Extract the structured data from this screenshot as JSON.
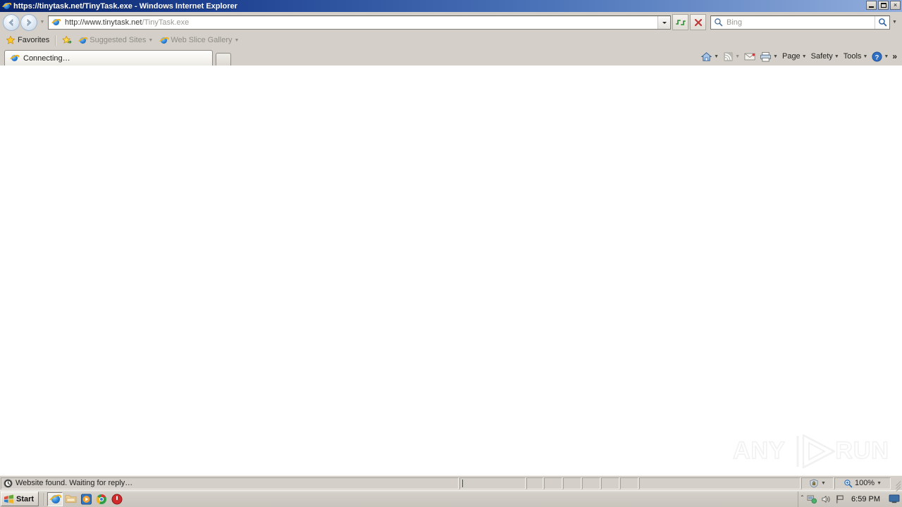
{
  "window": {
    "title": "https://tinytask.net/TinyTask.exe - Windows Internet Explorer",
    "icon": "ie-logo-icon",
    "controls": {
      "minimize": "Minimize",
      "restore": "Restore",
      "close": "×"
    }
  },
  "navigation": {
    "back_label": "Back",
    "forward_label": "Forward",
    "recent_pages_label": "Recent Pages",
    "address": {
      "scheme_host": "http://www.tinytask.net",
      "path": "/TinyTask.exe",
      "full": "http://www.tinytask.net/TinyTask.exe",
      "dropdown_label": "Address dropdown"
    },
    "refresh_label": "Refresh",
    "stop_label": "Stop",
    "search": {
      "placeholder": "Bing",
      "value": "",
      "go_label": "Search",
      "dropdown_label": "Search options"
    }
  },
  "favorites_bar": {
    "favorites_label": "Favorites",
    "items": [
      {
        "label": "Suggested Sites",
        "icon": "ie-logo-icon",
        "has_caret": true
      },
      {
        "label": "Web Slice Gallery",
        "icon": "ie-logo-icon",
        "has_caret": true
      }
    ]
  },
  "tabs": {
    "items": [
      {
        "label": "Connecting…",
        "icon": "ie-logo-icon",
        "active": true
      }
    ],
    "new_tab_label": "New Tab"
  },
  "command_bar": {
    "items": [
      {
        "label": "",
        "icon": "home-icon",
        "has_caret": true
      },
      {
        "label": "",
        "icon": "rss-feed-icon",
        "has_caret": true
      },
      {
        "label": "",
        "icon": "mail-icon",
        "has_caret": false
      },
      {
        "label": "",
        "icon": "print-icon",
        "has_caret": true
      },
      {
        "label": "Page",
        "icon": "",
        "has_caret": true
      },
      {
        "label": "Safety",
        "icon": "",
        "has_caret": true
      },
      {
        "label": "Tools",
        "icon": "",
        "has_caret": true
      },
      {
        "label": "",
        "icon": "help-icon",
        "has_caret": true
      }
    ],
    "overflow_label": "»"
  },
  "page": {
    "body_text": "",
    "watermark": {
      "left": "ANY",
      "right": "RUN",
      "logo": "play-triangle-icon"
    }
  },
  "status_bar": {
    "message": "Website found. Waiting for reply…",
    "message_icon": "wait-clock-icon",
    "security_zone_icon": "protected-mode-icon",
    "zoom_icon": "zoom-magnifier-icon",
    "zoom_level": "100%"
  },
  "taskbar": {
    "start_label": "Start",
    "quick_launch": [
      {
        "name": "internet-explorer",
        "active": true
      },
      {
        "name": "file-explorer",
        "active": false
      },
      {
        "name": "media-player",
        "active": false
      },
      {
        "name": "chrome-browser",
        "active": false
      },
      {
        "name": "red-shield-app",
        "active": false
      }
    ],
    "tray": {
      "expand_label": "˄",
      "network_icon": "network-icon",
      "volume_icon": "volume-icon",
      "flag_icon": "action-center-flag-icon",
      "clock": "6:59 PM",
      "show_desktop_label": "Show desktop"
    }
  },
  "colors": {
    "title_start": "#0a246a",
    "title_end": "#93aedd",
    "toolbar_bg": "#d4cfc9",
    "content_bg": "#ffffff",
    "accent_blue": "#2a7fd4"
  }
}
